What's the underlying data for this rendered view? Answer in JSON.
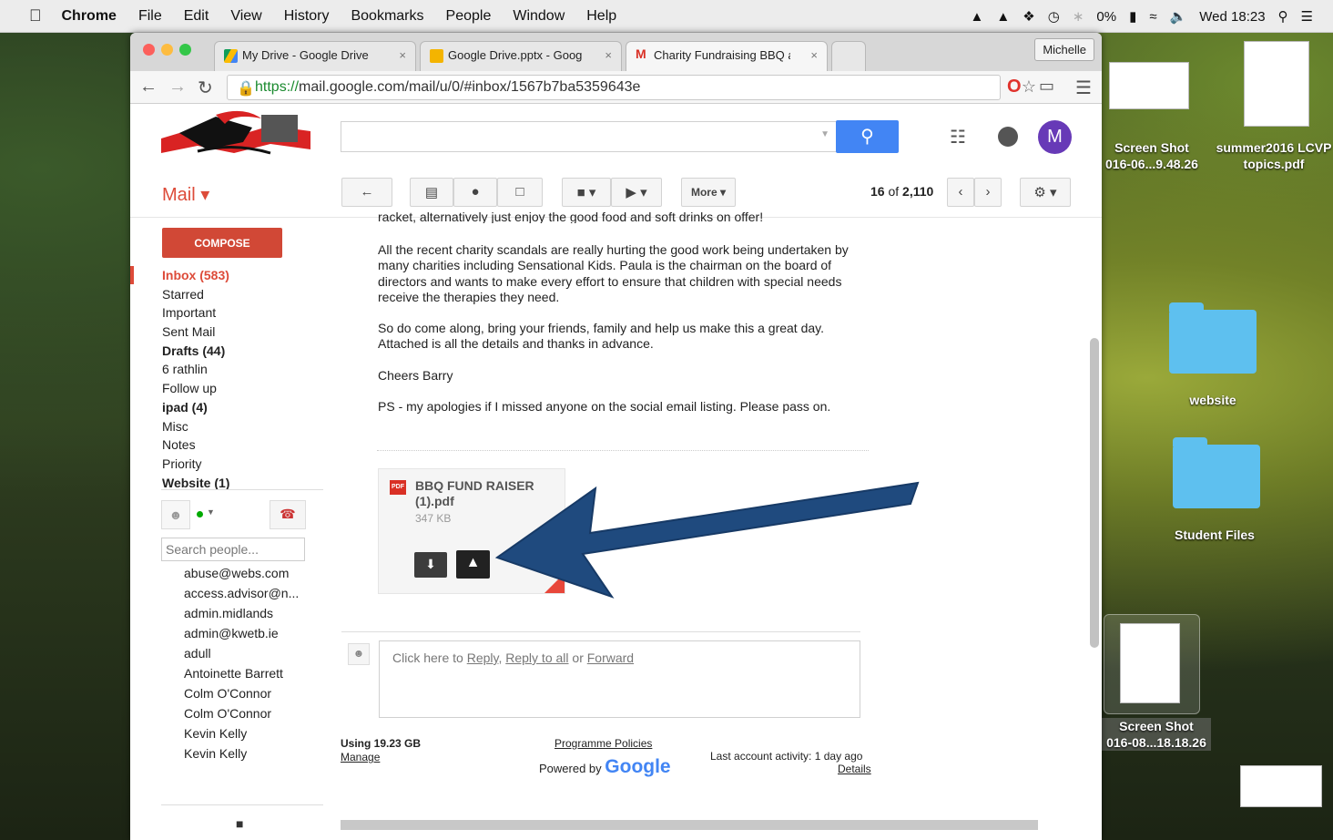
{
  "menubar": {
    "apple": "",
    "app": "Chrome",
    "menus": [
      "File",
      "Edit",
      "View",
      "History",
      "Bookmarks",
      "People",
      "Window",
      "Help"
    ],
    "battery": "0%",
    "clock": "Wed 18:23"
  },
  "browser": {
    "tabs": [
      {
        "label": "My Drive - Google Drive",
        "close": "×"
      },
      {
        "label": "Google Drive.pptx - Google",
        "close": "×"
      },
      {
        "label": "Charity Fundraising BBQ at",
        "close": "×"
      }
    ],
    "profile": "Michelle",
    "url_scheme": "https://",
    "url_rest": "mail.google.com/mail/u/0/#inbox/1567b7ba5359643e"
  },
  "gmail": {
    "avatar_letter": "M",
    "mail_label": "Mail ▾",
    "more_label": "More ▾",
    "pager_current": "16",
    "pager_of": "of",
    "pager_total": "2,110",
    "compose": "COMPOSE",
    "labels": [
      "Inbox (583)",
      "Starred",
      "Important",
      "Sent Mail",
      "Drafts (44)",
      "6 rathlin",
      "Follow up",
      "ipad (4)",
      "Misc",
      "Notes",
      "Priority",
      "Website (1)"
    ],
    "people_search_placeholder": "Search people...",
    "contacts": [
      "abuse@webs.com",
      "access.advisor@n...",
      "admin.midlands",
      "admin@kwetb.ie",
      "adull",
      "Antoinette Barrett",
      "Colm O'Connor",
      "Colm O'Connor",
      "Kevin Kelly",
      "Kevin Kelly"
    ]
  },
  "message": {
    "cut_line": "racket, alternatively just enjoy the good food and soft drinks on offer!",
    "para1": "All the recent charity scandals are really hurting the good work being undertaken by many charities including Sensational Kids.   Paula is the chairman on the board of directors and wants to make every effort to ensure that children with special needs receive the therapies they need.",
    "para2": "So do come along, bring your friends, family and help us make this a great day.   Attached is all the details and thanks in advance.",
    "para3": "Cheers    Barry",
    "para4": "PS - my apologies if I missed anyone on the social email listing.  Please pass on.",
    "attachment_badge": "PDF",
    "attachment_name": "BBQ FUND RAISER (1).pdf",
    "attachment_size": "347 KB",
    "reply_prefix": "Click here to ",
    "reply": "Reply",
    "reply_sep1": ", ",
    "reply_all": "Reply to all",
    "reply_sep2": " or ",
    "forward": "Forward"
  },
  "footer": {
    "usage": "Using 19.23 GB",
    "manage": "Manage",
    "policies": "Programme Policies",
    "powered_by": "Powered by",
    "google": "Google",
    "activity": "Last account activity: 1 day ago",
    "details": "Details"
  },
  "desktop": {
    "items": [
      {
        "label1": "Screen Shot",
        "label2": "016-06...9.48.26"
      },
      {
        "label1": "summer2016 LCVP",
        "label2": "topics.pdf"
      },
      {
        "label1": "website",
        "label2": ""
      },
      {
        "label1": "Student Files",
        "label2": ""
      },
      {
        "label1": "Screen Shot",
        "label2": "016-08...18.18.26"
      }
    ]
  },
  "colors": {
    "arrow": "#1f4a7e",
    "gmail_red": "#dd4b39",
    "search_blue": "#4285f4",
    "avatar": "#673ab7"
  }
}
